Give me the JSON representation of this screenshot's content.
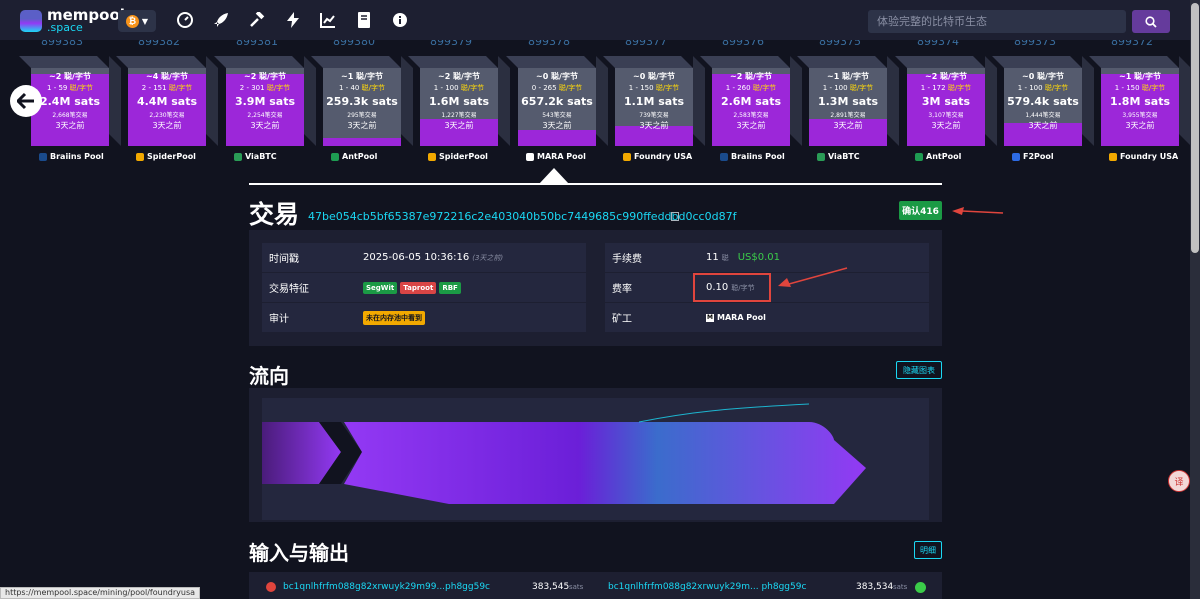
{
  "app": {
    "logo_line1": "mempool",
    "logo_line2": ".space",
    "network_symbol": "₿"
  },
  "nav": {
    "icons": [
      "dashboard-icon",
      "rocket-icon",
      "hammer-icon",
      "lightning-icon",
      "chart-icon",
      "book-icon",
      "info-icon"
    ]
  },
  "search": {
    "placeholder": "体验完整的比特币生态"
  },
  "blocks": [
    {
      "height": "899383",
      "fee": "~2 聪/字节",
      "range_lo": "1 - 59",
      "range_unit": "聪/字节",
      "size": "2.4M sats",
      "tx": "2,668笔交易",
      "ago": "3天之前",
      "fill": 0.92,
      "pool": "Braiins Pool",
      "pool_color": "#1a4b8c"
    },
    {
      "height": "899382",
      "fee": "~4 聪/字节",
      "range_lo": "2 - 151",
      "range_unit": "聪/字节",
      "size": "4.4M sats",
      "tx": "2,230笔交易",
      "ago": "3天之前",
      "fill": 0.92,
      "pool": "SpiderPool",
      "pool_color": "#f2a900"
    },
    {
      "height": "899381",
      "fee": "~2 聪/字节",
      "range_lo": "2 - 301",
      "range_unit": "聪/字节",
      "size": "3.9M sats",
      "tx": "2,254笔交易",
      "ago": "3天之前",
      "fill": 0.92,
      "pool": "ViaBTC",
      "pool_color": "#2a9c56"
    },
    {
      "height": "899380",
      "fee": "~1 聪/字节",
      "range_lo": "1 - 40",
      "range_unit": "聪/字节",
      "size": "259.3k sats",
      "tx": "295笔交易",
      "ago": "3天之前",
      "fill": 0.1,
      "pool": "AntPool",
      "pool_color": "#1e9c52"
    },
    {
      "height": "899379",
      "fee": "~2 聪/字节",
      "range_lo": "1 - 100",
      "range_unit": "聪/字节",
      "size": "1.6M sats",
      "tx": "1,227笔交易",
      "ago": "3天之前",
      "fill": 0.35,
      "pool": "SpiderPool",
      "pool_color": "#f2a900"
    },
    {
      "height": "899378",
      "fee": "~0 聪/字节",
      "range_lo": "0 - 265",
      "range_unit": "聪/字节",
      "size": "657.2k sats",
      "tx": "543笔交易",
      "ago": "3天之前",
      "fill": 0.2,
      "pool": "MARA Pool",
      "pool_color": "#ffffff"
    },
    {
      "height": "899377",
      "fee": "~0 聪/字节",
      "range_lo": "1 - 150",
      "range_unit": "聪/字节",
      "size": "1.1M sats",
      "tx": "739笔交易",
      "ago": "3天之前",
      "fill": 0.25,
      "pool": "Foundry USA",
      "pool_color": "#f2a900"
    },
    {
      "height": "899376",
      "fee": "~2 聪/字节",
      "range_lo": "1 - 260",
      "range_unit": "聪/字节",
      "size": "2.6M sats",
      "tx": "2,583笔交易",
      "ago": "3天之前",
      "fill": 0.92,
      "pool": "Braiins Pool",
      "pool_color": "#1a4b8c"
    },
    {
      "height": "899375",
      "fee": "~1 聪/字节",
      "range_lo": "1 - 100",
      "range_unit": "聪/字节",
      "size": "1.3M sats",
      "tx": "2,891笔交易",
      "ago": "3天之前",
      "fill": 0.35,
      "pool": "ViaBTC",
      "pool_color": "#2a9c56"
    },
    {
      "height": "899374",
      "fee": "~2 聪/字节",
      "range_lo": "1 - 172",
      "range_unit": "聪/字节",
      "size": "3M sats",
      "tx": "3,107笔交易",
      "ago": "3天之前",
      "fill": 0.92,
      "pool": "AntPool",
      "pool_color": "#1e9c52"
    },
    {
      "height": "899373",
      "fee": "~0 聪/字节",
      "range_lo": "1 - 100",
      "range_unit": "聪/字节",
      "size": "579.4k sats",
      "tx": "1,444笔交易",
      "ago": "3天之前",
      "fill": 0.3,
      "pool": "F2Pool",
      "pool_color": "#2d6be4"
    },
    {
      "height": "899372",
      "fee": "~1 聪/字节",
      "range_lo": "1 - 150",
      "range_unit": "聪/字节",
      "size": "1.8M sats",
      "tx": "3,955笔交易",
      "ago": "3天之前",
      "fill": 0.92,
      "pool": "Foundry USA",
      "pool_color": "#f2a900"
    }
  ],
  "tx": {
    "title": "交易",
    "txid": "47be054cb5bf65387e972216c2e403040b50bc7449685c990ffeddbd0cc0d87f",
    "confirmations": "确认416",
    "timestamp_label": "时间戳",
    "timestamp": "2025-06-05 10:36:16",
    "timestamp_ago": "(3天之前)",
    "features_label": "交易特征",
    "features": [
      "SegWit",
      "Taproot",
      "RBF"
    ],
    "audit_label": "审计",
    "audit": "未在内存池中看到",
    "fee_label": "手续费",
    "fee": "11",
    "fee_unit": "聪",
    "fee_usd": "US$0.01",
    "rate_label": "费率",
    "rate": "0.10",
    "rate_unit": "聪/字节",
    "miner_label": "矿工",
    "miner": "MARA Pool"
  },
  "flow": {
    "title": "流向",
    "hide_btn": "隐藏图表"
  },
  "io": {
    "title": "输入与输出",
    "details_btn": "明细",
    "input_addr": "bc1qnlhfrfm088g82xrwuyk29m99...ph8gg59c",
    "input_value": "383,545",
    "output_addr": "bc1qnlhfrfm088g82xrwuyk29m... ph8gg59c",
    "output_value": "383,534",
    "unit": "sats"
  },
  "status_url": "https://mempool.space/mining/pool/foundryusa",
  "translate_label": "译"
}
